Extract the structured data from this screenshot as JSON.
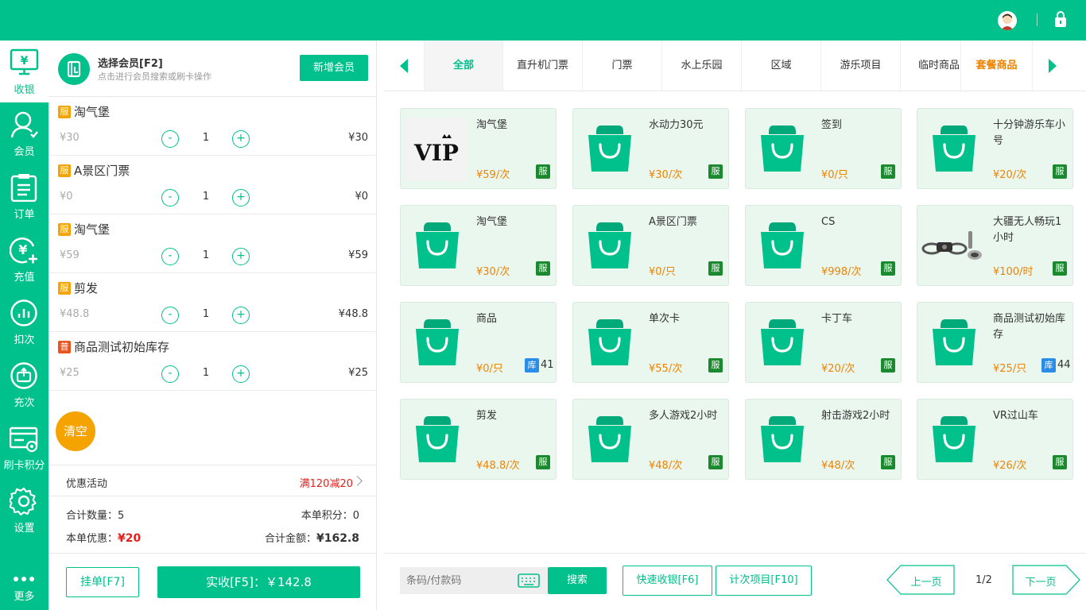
{
  "sidebar": {
    "items": [
      {
        "label": "收银"
      },
      {
        "label": "会员"
      },
      {
        "label": "订单"
      },
      {
        "label": "充值"
      },
      {
        "label": "扣次"
      },
      {
        "label": "充次"
      },
      {
        "label": "刷卡积分"
      },
      {
        "label": "设置"
      },
      {
        "label": "更多"
      }
    ]
  },
  "member": {
    "title": "选择会员[F2]",
    "subtitle": "点击进行会员搜索或刷卡操作",
    "add_label": "新增会员"
  },
  "cart": {
    "items": [
      {
        "badge": "服",
        "name": "淘气堡",
        "unit_price": "¥30",
        "qty": "1",
        "total": "¥30"
      },
      {
        "badge": "服",
        "name": "A景区门票",
        "unit_price": "¥0",
        "qty": "1",
        "total": "¥0"
      },
      {
        "badge": "服",
        "name": "淘气堡",
        "unit_price": "¥59",
        "qty": "1",
        "total": "¥59"
      },
      {
        "badge": "服",
        "name": "剪发",
        "unit_price": "¥48.8",
        "qty": "1",
        "total": "¥48.8"
      },
      {
        "badge": "普",
        "name": "商品测试初始库存",
        "unit_price": "¥25",
        "qty": "1",
        "total": "¥25"
      }
    ],
    "minus": "-",
    "plus": "+",
    "clear_label": "清空"
  },
  "promo": {
    "label": "优惠活动",
    "value": "满120减20"
  },
  "summary": {
    "count_label": "合计数量：",
    "count": "5",
    "points_label": "本单积分：",
    "points": "0",
    "discount_label": "本单优惠：",
    "discount": "¥20",
    "amount_label": "合计金额：",
    "amount": "¥162.8"
  },
  "actions": {
    "hold_label": "挂单[F7]",
    "pay_label": "实收[F5]：￥142.8"
  },
  "tabs": [
    {
      "label": "全部"
    },
    {
      "label": "直升机门票"
    },
    {
      "label": "门票"
    },
    {
      "label": "水上乐园"
    },
    {
      "label": "区域"
    },
    {
      "label": "游乐项目"
    },
    {
      "label": "临时商品"
    },
    {
      "label": "套餐商品"
    }
  ],
  "products": [
    {
      "name": "淘气堡",
      "price": "¥59/次",
      "tag": "服",
      "image": "vip"
    },
    {
      "name": "水动力30元",
      "price": "¥30/次",
      "tag": "服"
    },
    {
      "name": "签到",
      "price": "¥0/只",
      "tag": "服"
    },
    {
      "name": "十分钟游乐车小号",
      "price": "¥20/次",
      "tag": "服"
    },
    {
      "name": "淘气堡",
      "price": "¥30/次",
      "tag": "服"
    },
    {
      "name": "A景区门票",
      "price": "¥0/只",
      "tag": "服"
    },
    {
      "name": "CS",
      "price": "¥998/次",
      "tag": "服"
    },
    {
      "name": "大疆无人畅玩1小时",
      "price": "¥100/时",
      "tag": "服",
      "image": "drone"
    },
    {
      "name": "商品",
      "price": "¥0/只",
      "tag": "库",
      "stock": "41"
    },
    {
      "name": "单次卡",
      "price": "¥55/次",
      "tag": "服"
    },
    {
      "name": "卡丁车",
      "price": "¥20/次",
      "tag": "服"
    },
    {
      "name": "商品测试初始库存",
      "price": "¥25/只",
      "tag": "库",
      "stock": "44"
    },
    {
      "name": "剪发",
      "price": "¥48.8/次",
      "tag": "服"
    },
    {
      "name": "多人游戏2小时",
      "price": "¥48/次",
      "tag": "服"
    },
    {
      "name": "射击游戏2小时",
      "price": "¥48/次",
      "tag": "服"
    },
    {
      "name": "VR过山车",
      "price": "¥26/次",
      "tag": "服"
    }
  ],
  "footer": {
    "search_placeholder": "条码/付款码",
    "search_label": "搜索",
    "quick_label": "快速收银[F6]",
    "count_label": "计次项目[F10]",
    "prev_label": "上一页",
    "page": "1/2",
    "next_label": "下一页"
  },
  "colors": {
    "brand": "#00c08b",
    "price": "#f08300",
    "discount": "#e4211e",
    "clear": "#f5a300",
    "service_tag": "#1b8a2e",
    "stock_tag": "#2a8de8"
  }
}
